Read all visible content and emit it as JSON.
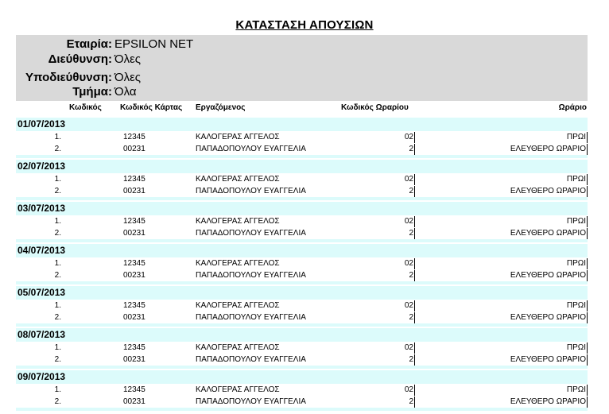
{
  "report": {
    "title": "ΚΑΤΑΣΤΑΣΗ ΑΠΟΥΣΙΩΝ"
  },
  "header": {
    "company_label": "Εταιρία:",
    "company_value": "EPSILON NET",
    "division_label": "Διεύθυνση:",
    "division_value": "Όλες",
    "subdivision_label": "Υποδιεύθυνση:",
    "subdivision_value": "Όλες",
    "department_label": "Τμήμα:",
    "department_value": "Όλα"
  },
  "columns": {
    "code": "Κωδικός",
    "card_code": "Κωδικός Κάρτας",
    "employee": "Εργαζόμενος",
    "schedule_code": "Κωδικός Ωραρίου",
    "schedule": "Ωράριο"
  },
  "groups": [
    {
      "date": "01/07/2013",
      "rows": [
        {
          "idx": "1.",
          "card": "12345",
          "name": "ΚΑΛΟΓΕΡΑΣ ΑΓΓΕΛΟΣ",
          "code": "02",
          "schedule": "ΠΡΩΙ"
        },
        {
          "idx": "2.",
          "card": "00231",
          "name": "ΠΑΠΑΔΟΠΟΥΛΟΥ ΕΥΑΓΓΕΛΙΑ",
          "code": "2",
          "schedule": "ΕΛΕΥΘΕΡΟ ΩΡΑΡΙΟ"
        }
      ]
    },
    {
      "date": "02/07/2013",
      "rows": [
        {
          "idx": "1.",
          "card": "12345",
          "name": "ΚΑΛΟΓΕΡΑΣ ΑΓΓΕΛΟΣ",
          "code": "02",
          "schedule": "ΠΡΩΙ"
        },
        {
          "idx": "2.",
          "card": "00231",
          "name": "ΠΑΠΑΔΟΠΟΥΛΟΥ ΕΥΑΓΓΕΛΙΑ",
          "code": "2",
          "schedule": "ΕΛΕΥΘΕΡΟ ΩΡΑΡΙΟ"
        }
      ]
    },
    {
      "date": "03/07/2013",
      "rows": [
        {
          "idx": "1.",
          "card": "12345",
          "name": "ΚΑΛΟΓΕΡΑΣ ΑΓΓΕΛΟΣ",
          "code": "02",
          "schedule": "ΠΡΩΙ"
        },
        {
          "idx": "2.",
          "card": "00231",
          "name": "ΠΑΠΑΔΟΠΟΥΛΟΥ ΕΥΑΓΓΕΛΙΑ",
          "code": "2",
          "schedule": "ΕΛΕΥΘΕΡΟ ΩΡΑΡΙΟ"
        }
      ]
    },
    {
      "date": "04/07/2013",
      "rows": [
        {
          "idx": "1.",
          "card": "12345",
          "name": "ΚΑΛΟΓΕΡΑΣ ΑΓΓΕΛΟΣ",
          "code": "02",
          "schedule": "ΠΡΩΙ"
        },
        {
          "idx": "2.",
          "card": "00231",
          "name": "ΠΑΠΑΔΟΠΟΥΛΟΥ ΕΥΑΓΓΕΛΙΑ",
          "code": "2",
          "schedule": "ΕΛΕΥΘΕΡΟ ΩΡΑΡΙΟ"
        }
      ]
    },
    {
      "date": "05/07/2013",
      "rows": [
        {
          "idx": "1.",
          "card": "12345",
          "name": "ΚΑΛΟΓΕΡΑΣ ΑΓΓΕΛΟΣ",
          "code": "02",
          "schedule": "ΠΡΩΙ"
        },
        {
          "idx": "2.",
          "card": "00231",
          "name": "ΠΑΠΑΔΟΠΟΥΛΟΥ ΕΥΑΓΓΕΛΙΑ",
          "code": "2",
          "schedule": "ΕΛΕΥΘΕΡΟ ΩΡΑΡΙΟ"
        }
      ]
    },
    {
      "date": "08/07/2013",
      "rows": [
        {
          "idx": "1.",
          "card": "12345",
          "name": "ΚΑΛΟΓΕΡΑΣ ΑΓΓΕΛΟΣ",
          "code": "02",
          "schedule": "ΠΡΩΙ"
        },
        {
          "idx": "2.",
          "card": "00231",
          "name": "ΠΑΠΑΔΟΠΟΥΛΟΥ ΕΥΑΓΓΕΛΙΑ",
          "code": "2",
          "schedule": "ΕΛΕΥΘΕΡΟ ΩΡΑΡΙΟ"
        }
      ]
    },
    {
      "date": "09/07/2013",
      "rows": [
        {
          "idx": "1.",
          "card": "12345",
          "name": "ΚΑΛΟΓΕΡΑΣ ΑΓΓΕΛΟΣ",
          "code": "02",
          "schedule": "ΠΡΩΙ"
        },
        {
          "idx": "2.",
          "card": "00231",
          "name": "ΠΑΠΑΔΟΠΟΥΛΟΥ ΕΥΑΓΓΕΛΙΑ",
          "code": "2",
          "schedule": "ΕΛΕΥΘΕΡΟ ΩΡΑΡΙΟ"
        }
      ]
    }
  ],
  "colors": {
    "header_bg": "#d9d9d9",
    "date_band_bg": "#dcfbfb"
  }
}
